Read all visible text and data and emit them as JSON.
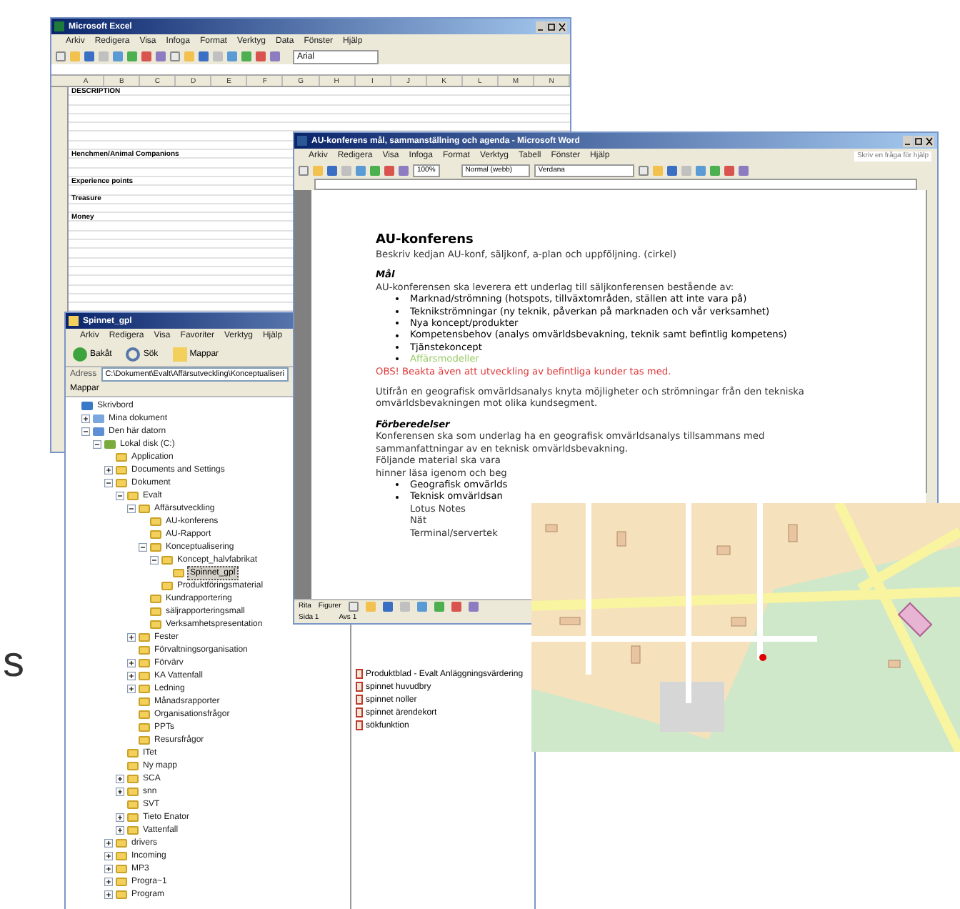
{
  "excel": {
    "title": "Microsoft Excel",
    "menus": [
      "Arkiv",
      "Redigera",
      "Visa",
      "Infoga",
      "Format",
      "Verktyg",
      "Data",
      "Fönster",
      "Hjälp"
    ],
    "font": "Arial",
    "columns": [
      "A",
      "B",
      "C",
      "D",
      "E",
      "F",
      "G",
      "H",
      "I",
      "J",
      "K",
      "L",
      "M",
      "N"
    ],
    "labels": [
      "DESCRIPTION",
      "Henchmen/Animal Companions",
      "Experience points",
      "Treasure",
      "Money"
    ]
  },
  "explorer": {
    "title": "Spinnet_gpl",
    "menus": [
      "Arkiv",
      "Redigera",
      "Visa",
      "Favoriter",
      "Verktyg",
      "Hjälp"
    ],
    "toolbar": [
      "Bakåt",
      "Sök",
      "Mappar"
    ],
    "address_label": "Adress",
    "address": "C:\\Dokument\\Evalt\\Affärsutveckling\\Konceptualiseri",
    "pane_title": "Mappar",
    "tree": [
      {
        "label": "Skrivbord",
        "kind": "desktop",
        "selected": false,
        "children": [
          {
            "label": "Mina dokument",
            "kind": "documents",
            "expanded": false,
            "selected": false
          },
          {
            "label": "Den här datorn",
            "kind": "computer",
            "expanded": true,
            "selected": false,
            "children": [
              {
                "label": "Lokal disk (C:)",
                "kind": "drive",
                "expanded": true,
                "selected": false,
                "children": [
                  {
                    "label": "Application",
                    "kind": "folder",
                    "selected": false
                  },
                  {
                    "label": "Documents and Settings",
                    "kind": "folder",
                    "expanded": false,
                    "selected": false
                  },
                  {
                    "label": "Dokument",
                    "kind": "folder",
                    "expanded": true,
                    "selected": false,
                    "children": [
                      {
                        "label": "Evalt",
                        "kind": "folder",
                        "expanded": true,
                        "selected": false,
                        "children": [
                          {
                            "label": "Affärsutveckling",
                            "kind": "folder",
                            "expanded": true,
                            "selected": false,
                            "children": [
                              {
                                "label": "AU-konferens",
                                "kind": "folder",
                                "selected": false
                              },
                              {
                                "label": "AU-Rapport",
                                "kind": "folder",
                                "selected": false
                              },
                              {
                                "label": "Konceptualisering",
                                "kind": "folder",
                                "expanded": true,
                                "selected": false,
                                "children": [
                                  {
                                    "label": "Koncept_halvfabrikat",
                                    "kind": "folder",
                                    "expanded": true,
                                    "selected": false,
                                    "children": [
                                      {
                                        "label": "Spinnet_gpl",
                                        "kind": "folder",
                                        "selected": true
                                      }
                                    ]
                                  },
                                  {
                                    "label": "Produktföringsmaterial",
                                    "kind": "folder",
                                    "selected": false
                                  }
                                ]
                              },
                              {
                                "label": "Kundrapportering",
                                "kind": "folder",
                                "selected": false
                              },
                              {
                                "label": "säljrapporteringsmall",
                                "kind": "folder",
                                "selected": false
                              },
                              {
                                "label": "Verksamhetspresentation",
                                "kind": "folder",
                                "selected": false
                              }
                            ]
                          },
                          {
                            "label": "Fester",
                            "kind": "folder",
                            "expanded": false,
                            "selected": false
                          },
                          {
                            "label": "Förvaltningsorganisation",
                            "kind": "folder",
                            "selected": false
                          },
                          {
                            "label": "Förvärv",
                            "kind": "folder",
                            "expanded": false,
                            "selected": false
                          },
                          {
                            "label": "KA Vattenfall",
                            "kind": "folder",
                            "expanded": false,
                            "selected": false
                          },
                          {
                            "label": "Ledning",
                            "kind": "folder",
                            "expanded": false,
                            "selected": false
                          },
                          {
                            "label": "Månadsrapporter",
                            "kind": "folder",
                            "selected": false
                          },
                          {
                            "label": "Organisationsfrågor",
                            "kind": "folder",
                            "selected": false
                          },
                          {
                            "label": "PPTs",
                            "kind": "folder",
                            "selected": false
                          },
                          {
                            "label": "Resursfrågor",
                            "kind": "folder",
                            "selected": false
                          }
                        ]
                      },
                      {
                        "label": "ITet",
                        "kind": "folder",
                        "selected": false
                      },
                      {
                        "label": "Ny mapp",
                        "kind": "folder",
                        "selected": false
                      },
                      {
                        "label": "SCA",
                        "kind": "folder",
                        "expanded": false,
                        "selected": false
                      },
                      {
                        "label": "snn",
                        "kind": "folder",
                        "expanded": false,
                        "selected": false
                      },
                      {
                        "label": "SVT",
                        "kind": "folder",
                        "selected": false
                      },
                      {
                        "label": "Tieto Enator",
                        "kind": "folder",
                        "expanded": false,
                        "selected": false
                      },
                      {
                        "label": "Vattenfall",
                        "kind": "folder",
                        "expanded": false,
                        "selected": false
                      }
                    ]
                  },
                  {
                    "label": "drivers",
                    "kind": "folder",
                    "expanded": false,
                    "selected": false
                  },
                  {
                    "label": "Incoming",
                    "kind": "folder",
                    "expanded": false,
                    "selected": false
                  },
                  {
                    "label": "MP3",
                    "kind": "folder",
                    "expanded": false,
                    "selected": false
                  },
                  {
                    "label": "Progra~1",
                    "kind": "folder",
                    "expanded": false,
                    "selected": false
                  },
                  {
                    "label": "Program",
                    "kind": "folder",
                    "expanded": false,
                    "selected": false
                  }
                ]
              }
            ]
          }
        ]
      }
    ],
    "files": [
      "Produktblad - Evalt Anläggningsvärdering",
      "spinnet huvudbry",
      "spinnet noller",
      "spinnet ärendekort",
      "sökfunktion"
    ]
  },
  "word": {
    "title": "AU-konferens mål, sammanställning och agenda - Microsoft Word",
    "menus": [
      "Arkiv",
      "Redigera",
      "Visa",
      "Infoga",
      "Format",
      "Verktyg",
      "Tabell",
      "Fönster",
      "Hjälp"
    ],
    "help_placeholder": "Skriv en fråga för hjälp",
    "zoom": "100%",
    "style": "Normal (webb)",
    "font": "Verdana",
    "body": [
      {
        "kind": "heading",
        "text": "AU-konferens"
      },
      {
        "kind": "text",
        "text": "Beskriv kedjan AU-konf, säljkonf, a-plan och uppföljning. (cirkel)"
      },
      {
        "kind": "subheading",
        "text": "Mål"
      },
      {
        "kind": "text",
        "text": "AU-konferensen ska leverera ett underlag till säljkonferensen bestående av:"
      },
      {
        "kind": "bullets",
        "items": [
          {
            "text": "Marknad/strömning (hotspots, tillväxtområden, ställen att inte vara på)",
            "color": "#000000"
          },
          {
            "text": "Teknikströmningar (ny teknik, påverkan på marknaden och vår verksamhet)",
            "color": "#000000"
          },
          {
            "text": "Nya koncept/produkter",
            "color": "#000000"
          },
          {
            "text": "Kompetensbehov  (analys omvärldsbevakning, teknik samt befintlig kompetens)",
            "color": "#000000"
          },
          {
            "text": "Tjänstekoncept",
            "color": "#000000"
          },
          {
            "text": "Affärsmodeller",
            "color": "#99cc66"
          }
        ]
      },
      {
        "kind": "note",
        "text": "OBS! Beakta även att utveckling av befintliga kunder tas med."
      },
      {
        "kind": "text",
        "text": "Utifrån en geografisk omvärldsanalys knyta möjligheter och strömningar från den tekniska omvärldsbevakningen mot olika kundsegment."
      },
      {
        "kind": "subheading",
        "text": "Förberedelser"
      },
      {
        "kind": "text",
        "text": "Konferensen ska som underlag ha en geografisk omvärldsanalys tillsammans med sammanfattningar av en teknisk omvärldsbevakning."
      },
      {
        "kind": "line",
        "text": "Följande material ska vara"
      },
      {
        "kind": "line",
        "text": "hinner läsa igenom och beg"
      },
      {
        "kind": "bullets",
        "items": [
          {
            "text": "Geografisk omvärlds",
            "color": "#000000"
          },
          {
            "text": "Teknisk omvärldsan",
            "color": "#000000"
          }
        ]
      },
      {
        "kind": "sub",
        "text": "Lotus Notes"
      },
      {
        "kind": "sub",
        "text": "Nät"
      },
      {
        "kind": "sub",
        "text": "Terminal/servertek"
      }
    ],
    "draw_toolbar": [
      "Rita",
      "Figurer"
    ],
    "status": [
      "Sida 1",
      "Avs 1"
    ]
  },
  "side_letter": "s"
}
